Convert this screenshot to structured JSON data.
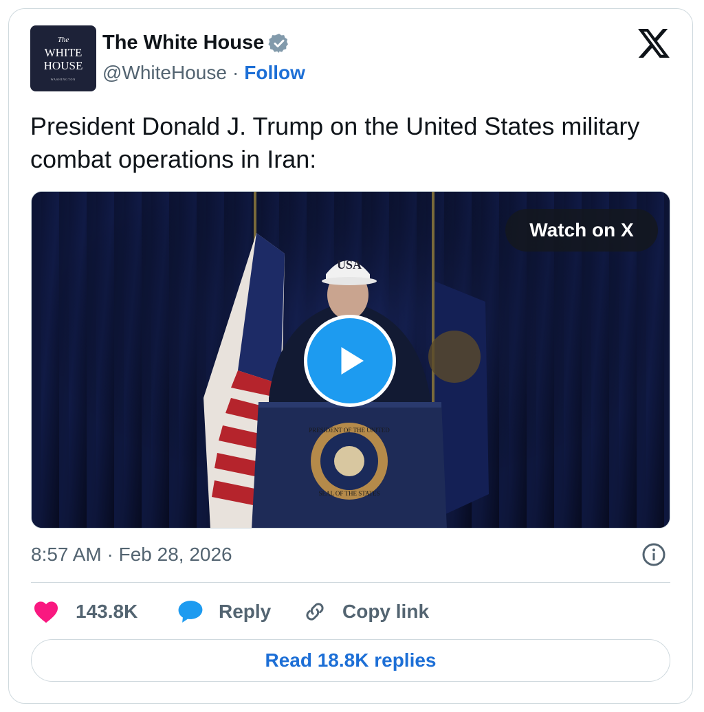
{
  "account": {
    "name": "The White House",
    "handle": "@WhiteHouse",
    "separator": "·",
    "follow_label": "Follow",
    "verified_icon": "verified-badge-icon",
    "avatar": {
      "line1": "The",
      "line2": "WHITE",
      "line3": "HOUSE",
      "line4": "WASHINGTON"
    }
  },
  "post": {
    "text": "President Donald J. Trump on the United States military combat operations in Iran:",
    "timestamp": "8:57 AM · Feb 28, 2026"
  },
  "media": {
    "watch_label": "Watch on X",
    "cap_text": "USA",
    "seal_top": "PRESIDENT OF THE UNITED",
    "seal_bottom": "SEAL OF THE STATES",
    "play_icon": "play-icon"
  },
  "actions": {
    "likes": "143.8K",
    "reply_label": "Reply",
    "copy_label": "Copy link"
  },
  "read_replies_label": "Read 18.8K replies",
  "colors": {
    "accent": "#1d6fd6",
    "like": "#f91880",
    "reply_icon": "#1d9bf0",
    "muted": "#536471",
    "border": "#cfd9de"
  }
}
